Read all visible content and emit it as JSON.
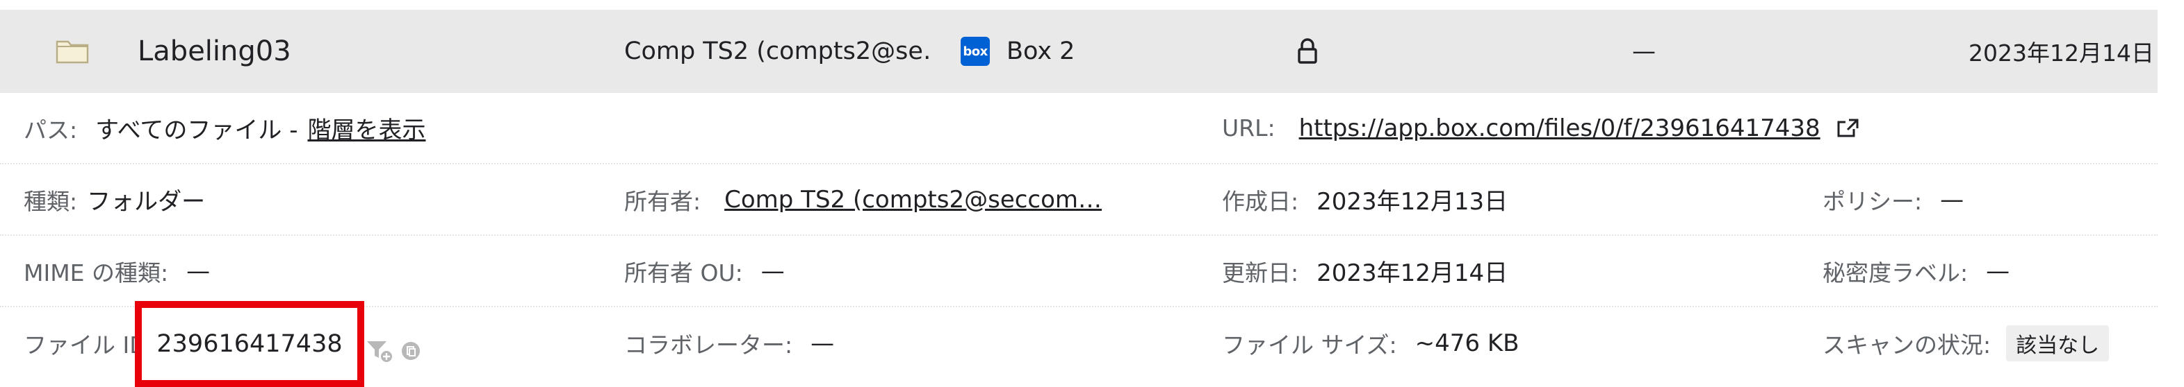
{
  "file_row": {
    "name": "Labeling03",
    "owner": "Comp TS2 (compts2@se…",
    "source_name": "Box 2",
    "source_logo_text": "box",
    "dash": "—",
    "date": "2023年12月14日"
  },
  "details": {
    "path_label": "パス:",
    "path_value": "すべてのファイル -",
    "path_link": "階層を表示",
    "url_label": "URL:",
    "url_value": "https://app.box.com/files/0/f/239616417438",
    "type_label": "種類:",
    "type_value": "フォルダー",
    "owner_label": "所有者:",
    "owner_value": "Comp TS2 (compts2@seccom…",
    "created_label": "作成日:",
    "created_value": "2023年12月13日",
    "policy_label": "ポリシー:",
    "policy_value": "—",
    "mime_label": "MIME の種類:",
    "mime_value": "—",
    "owner_ou_label": "所有者 OU:",
    "owner_ou_value": "—",
    "updated_label": "更新日:",
    "updated_value": "2023年12月14日",
    "sensitivity_label": "秘密度ラベル:",
    "sensitivity_value": "—",
    "file_id_label": "ファイル ID",
    "file_id_value": "239616417438",
    "collaborators_label": "コラボレーター:",
    "collaborators_value": "—",
    "size_label": "ファイル サイズ:",
    "size_value": "~476 KB",
    "scan_label": "スキャンの状況:",
    "scan_value": "該当なし"
  },
  "colors": {
    "header_bg": "#e9e9e9",
    "highlight_border": "#e8000b",
    "box_brand": "#0061d5"
  },
  "icons": [
    "folder-icon",
    "box-logo-icon",
    "lock-icon",
    "external-link-icon",
    "filter-add-icon",
    "copy-icon"
  ]
}
